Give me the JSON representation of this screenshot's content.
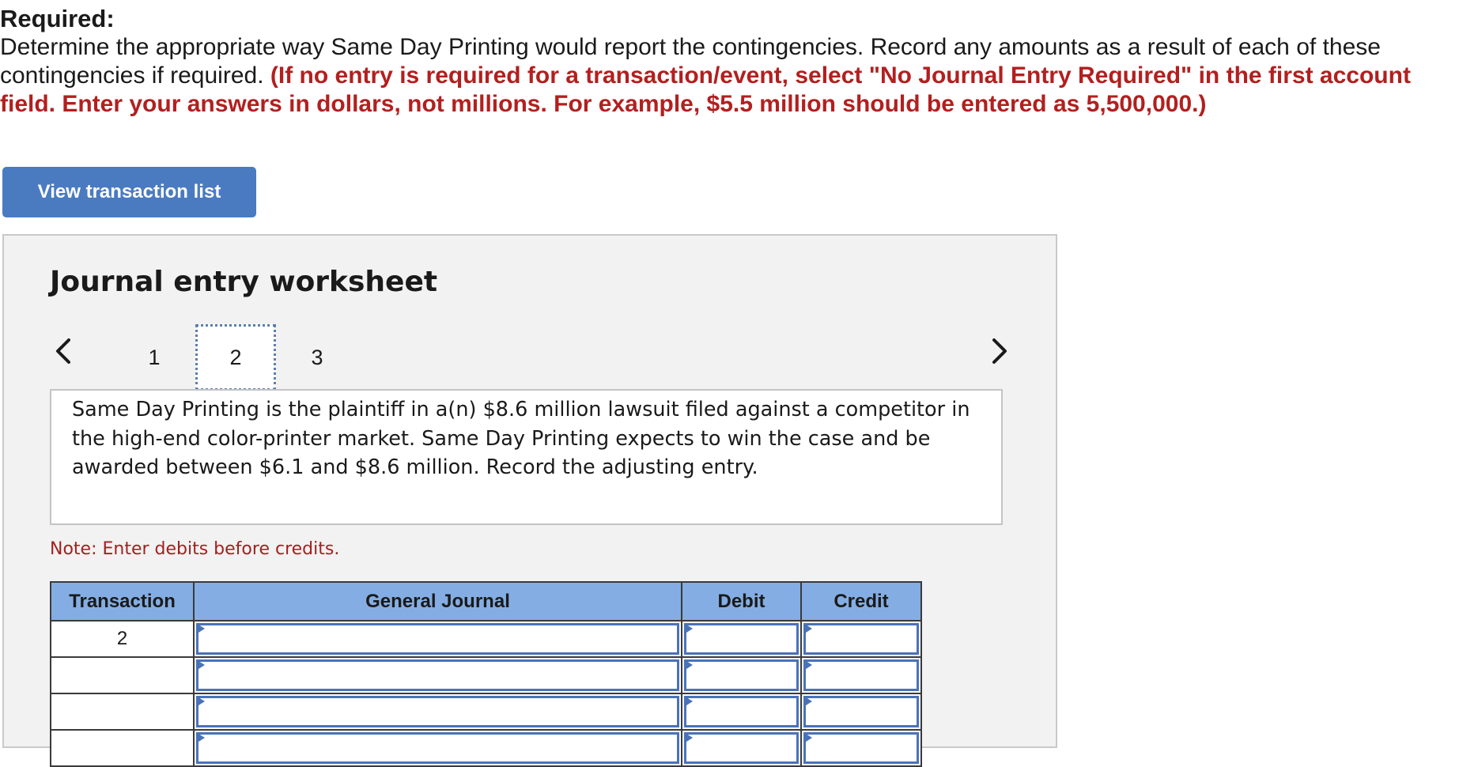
{
  "required": {
    "title": "Required:",
    "instruction": "Determine the appropriate way Same Day Printing would report the contingencies. Record any amounts as a result of each of these contingencies if required. ",
    "emphasis": "(If no entry is required for a transaction/event, select \"No Journal Entry Required\" in the first account field. Enter your answers in dollars, not millions. For example, $5.5 million should be entered as 5,500,000.)"
  },
  "view_button": {
    "label": "View transaction list"
  },
  "worksheet": {
    "title": "Journal entry worksheet",
    "tabs": [
      {
        "label": "1",
        "active": false
      },
      {
        "label": "2",
        "active": true
      },
      {
        "label": "3",
        "active": false
      }
    ],
    "description": "Same Day Printing is the plaintiff in a(n) $8.6 million lawsuit filed against a competitor in the high-end color-printer market. Same Day Printing expects to win the case and be awarded between $6.1 and $8.6 million. Record the adjusting entry.",
    "note": "Note: Enter debits before credits."
  },
  "journal_table": {
    "headers": {
      "transaction": "Transaction",
      "general_journal": "General Journal",
      "debit": "Debit",
      "credit": "Credit"
    },
    "rows": [
      {
        "transaction": "2",
        "account": "",
        "debit": "",
        "credit": ""
      },
      {
        "transaction": "",
        "account": "",
        "debit": "",
        "credit": ""
      },
      {
        "transaction": "",
        "account": "",
        "debit": "",
        "credit": ""
      },
      {
        "transaction": "",
        "account": "",
        "debit": "",
        "credit": ""
      }
    ]
  },
  "colors": {
    "emphasis_red": "#b31f1f",
    "button_blue": "#4a7bc0",
    "header_blue": "#84aee3",
    "input_border_blue": "#4a72b8"
  }
}
